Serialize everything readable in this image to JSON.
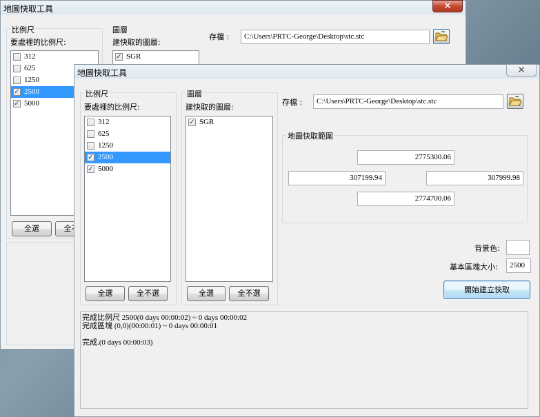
{
  "back": {
    "title": "地圖快取工具",
    "close_icon": "✕",
    "scale_group": "比例尺",
    "scale_caption": "要處裡的比例尺:",
    "scales": [
      {
        "label": "312",
        "checked": false,
        "selected": false
      },
      {
        "label": "625",
        "checked": false,
        "selected": false
      },
      {
        "label": "1250",
        "checked": false,
        "selected": false
      },
      {
        "label": "2500",
        "checked": true,
        "selected": true
      },
      {
        "label": "5000",
        "checked": true,
        "selected": false
      }
    ],
    "select_all": "全選",
    "deselect_all": "全不選",
    "layer_group": "圖層",
    "layer_caption": "建快取的圖層:",
    "layers": [
      {
        "label": "SGR",
        "checked": true
      }
    ],
    "save_label": "存檔 :",
    "save_path": "C:\\Users\\PRTC-George\\Desktop\\stc.stc"
  },
  "front": {
    "title": "地圖快取工具",
    "close_icon": "✕",
    "scale_group": "比例尺",
    "scale_caption": "要處裡的比例尺:",
    "scales": [
      {
        "label": "312",
        "checked": false,
        "selected": false
      },
      {
        "label": "625",
        "checked": false,
        "selected": false
      },
      {
        "label": "1250",
        "checked": false,
        "selected": false
      },
      {
        "label": "2500",
        "checked": true,
        "selected": true
      },
      {
        "label": "5000",
        "checked": true,
        "selected": false
      }
    ],
    "scale_select_all": "全選",
    "scale_deselect_all": "全不選",
    "layer_group": "圖層",
    "layer_caption": "建快取的圖層:",
    "layers": [
      {
        "label": "SGR",
        "checked": true
      }
    ],
    "layer_select_all": "全選",
    "layer_deselect_all": "全不選",
    "save_label": "存檔 :",
    "save_path": "C:\\Users\\PRTC-George\\Desktop\\stc.stc",
    "extent_group": "地圖快取範圍",
    "extent": {
      "top": "2775300.06",
      "left": "307199.94",
      "right": "307999.98",
      "bottom": "2774700.06"
    },
    "bg_color_label": "背景色:",
    "bg_color_value": "#ffffff",
    "tile_size_label": "基本區塊大小:",
    "tile_size": "2500",
    "start_button": "開始建立快取",
    "log": [
      "完成比例尺 2500(0 days 00:00:02) ~ 0 days 00:00:02",
      "完成區塊 (0,0)(00:00:01) ~ 0 days 00:00:01",
      "",
      "完成.(0 days 00:00:03)"
    ]
  },
  "icons": {
    "folder": "folder-open-icon",
    "check": "✓"
  }
}
